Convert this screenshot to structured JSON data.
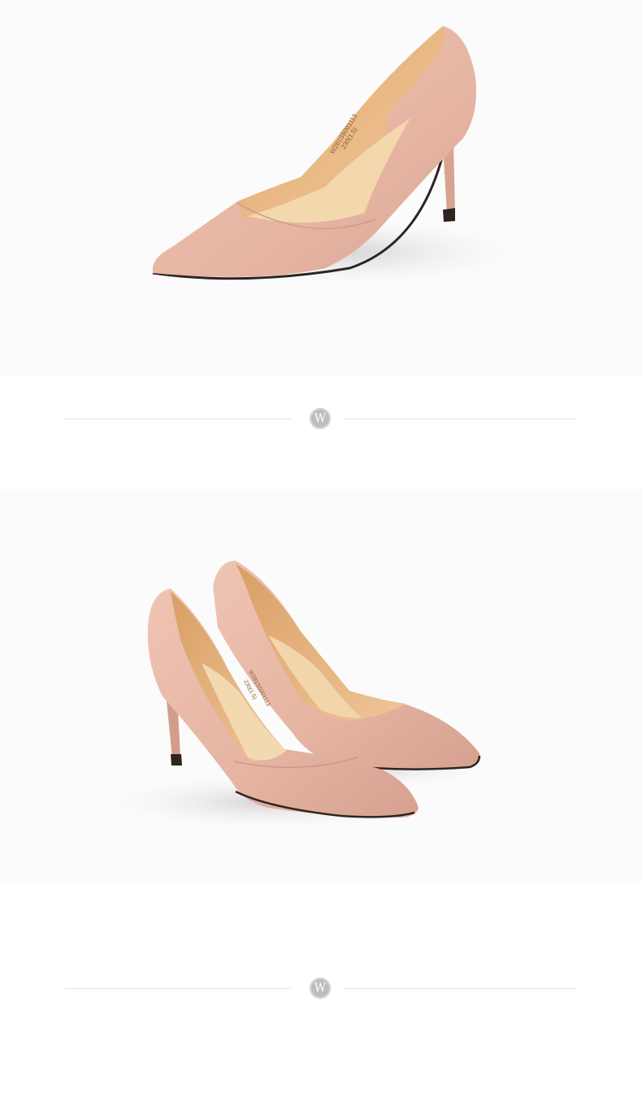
{
  "sections": [
    {
      "photo": {
        "subject": "single pink suede pointed-toe stiletto pump, side view",
        "insole_print": [
          "W281S5001113",
          "230(1.5)"
        ]
      },
      "divider": {
        "badge_letter": "W",
        "badge_icon": "w-logo-icon"
      }
    },
    {
      "photo": {
        "subject": "pair of pink suede pointed-toe stiletto pumps, angled view",
        "insole_print": [
          "W281S5001113",
          "230(1.5)"
        ]
      },
      "divider": {
        "badge_letter": "W",
        "badge_icon": "w-logo-icon"
      }
    }
  ],
  "colors": {
    "suede": "#e8b9a8",
    "suede_shadow": "#d49f8e",
    "lining": "#e7b883",
    "insole": "#f2d4a8",
    "sole": "#2d2422",
    "divider_line": "#e4e4e4",
    "badge": "#bdbdbd"
  }
}
